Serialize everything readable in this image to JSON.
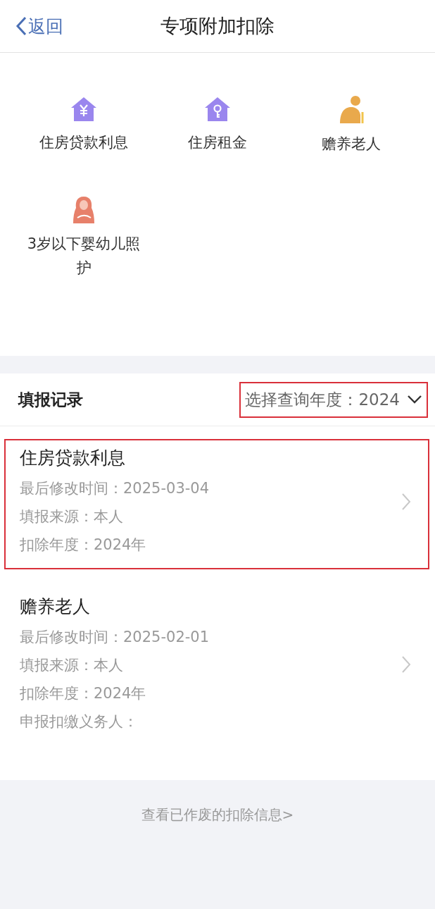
{
  "nav_bar": {
    "back": "返回",
    "title": "专项附加扣除"
  },
  "categories": [
    {
      "label": "住房贷款利息",
      "kind": "house-yuan",
      "color": "#9a86ee"
    },
    {
      "label": "住房租金",
      "kind": "house-key",
      "color": "#9a86ee"
    },
    {
      "label": "赡养老人",
      "kind": "elder",
      "color": "#e9a94c"
    },
    {
      "label": "3岁以下婴幼儿照护",
      "kind": "mother",
      "color": "#e7806a"
    }
  ],
  "records_header": {
    "title": "填报记录",
    "year_selector": {
      "label": "选择查询年度：",
      "value": "2024",
      "highlighted": true
    }
  },
  "records": [
    {
      "title": "住房贷款利息",
      "highlighted": true,
      "lines": [
        "最后修改时间：2025-03-04",
        "填报来源：本人",
        "扣除年度：2024年"
      ]
    },
    {
      "title": "赡养老人",
      "highlighted": false,
      "lines": [
        "最后修改时间：2025-02-01",
        "填报来源：本人",
        "扣除年度：2024年",
        "申报扣缴义务人："
      ]
    }
  ],
  "footer_link": "查看已作废的扣除信息>"
}
